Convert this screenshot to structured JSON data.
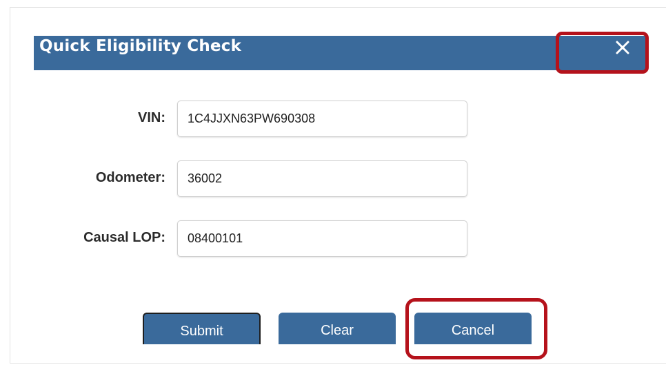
{
  "dialog": {
    "title": "Quick Eligibility Check",
    "close_icon": "close-icon"
  },
  "form": {
    "vin": {
      "label": "VIN:",
      "value": "1C4JJXN63PW690308"
    },
    "odometer": {
      "label": "Odometer:",
      "value": "36002"
    },
    "causal_lop": {
      "label": "Causal LOP:",
      "value": "08400101"
    }
  },
  "buttons": {
    "submit": "Submit",
    "clear": "Clear",
    "cancel": "Cancel"
  },
  "colors": {
    "title_bar": "#3a6a9b",
    "button": "#3a6a9b",
    "highlight": "#b5121b"
  }
}
